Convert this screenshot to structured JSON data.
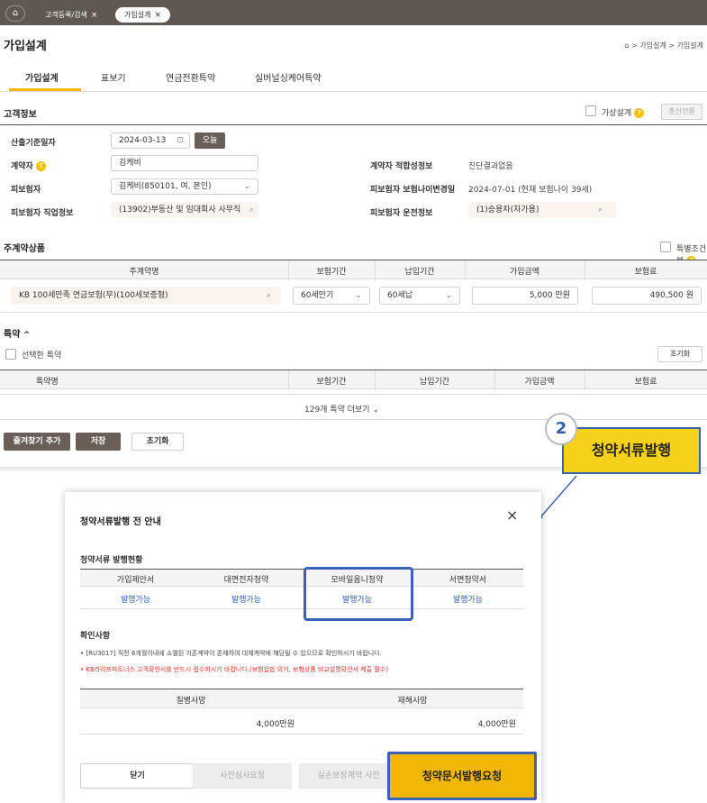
{
  "topbar": {
    "home_icon": "home-icon",
    "tabs": [
      {
        "label": "고객등록/검색",
        "close": "×"
      },
      {
        "label": "가입설계",
        "close": "×"
      }
    ]
  },
  "header": {
    "title": "가입설계",
    "breadcrumb": "⌂ > 가입설계 > 가입설계"
  },
  "subtabs": [
    "가입설계",
    "표보기",
    "연금전환특약",
    "실버널싱케어특약"
  ],
  "customer": {
    "section_title": "고객정보",
    "virtual_design_label": "가상설계",
    "total_convert_label": "총신전환",
    "calc_date_label": "산출기준일자",
    "calc_date_value": "2024-03-13",
    "today_label": "오늘",
    "contractor_label": "계약자",
    "contractor_value": "김케비",
    "suitability_label": "계약자 적합성정보",
    "suitability_value": "진단결과없음",
    "insured_label": "피보험자",
    "insured_value": "김케비(850101, 여, 본인)",
    "age_change_label": "피보험자 보험나이변경일",
    "age_change_value": "2024-07-01 (현재 보험나이 39세)",
    "job_label": "피보험자 직업정보",
    "job_value": "(13902)부동산 및 임대회사 사무직",
    "driving_label": "피보험자 운전정보",
    "driving_value": "(1)승용차(자가용)"
  },
  "main_product": {
    "section_title": "주계약상품",
    "special_cond_label": "특별조건부",
    "columns": [
      "주계약명",
      "보험기간",
      "납입기간",
      "가입금액",
      "보험료"
    ],
    "name": "KB 100세만족 연금보험(무)(100세보증형)",
    "period": "60세만기",
    "pay_period": "60세납",
    "amount": "5,000 만원",
    "premium": "490,500 원"
  },
  "rider": {
    "section_title": "특약",
    "collapse_icon": "^",
    "selected_label": "선택한 특약",
    "reset_label": "초기화",
    "columns": [
      "특약명",
      "보험기간",
      "납입기간",
      "가입금액",
      "보험료"
    ],
    "more_label": "129개 특약 더보기 ⌄"
  },
  "bottom_buttons": {
    "favorite": "즐겨찾기 추가",
    "save": "저장",
    "reset": "초기화"
  },
  "callout": {
    "step": "2",
    "label": "청약서류발행"
  },
  "modal": {
    "title": "청약서류발행 전 안내",
    "close_icon": "×",
    "status_title": "청약서류 발행현황",
    "status_columns": [
      "가입제안서",
      "대면전자청약",
      "모바일옴니청약",
      "서면청약서"
    ],
    "status_values": [
      "발행가능",
      "발행가능",
      "발행가능",
      "발행가능"
    ],
    "check_title": "확인사항",
    "note1": "• [RU3017] 직전 6개월이내에 소멸된 기존계약이 존재하여 대체계약에 해당될 수 있으므로 확인하시기 바랍니다.",
    "note2": "• KB라이프파트너스 고객확인서를 반드시 접수하시기 바랍니다.(보험업법 의거, 보험상품 비교설명확인서 제출 필수)",
    "death_columns": [
      "질병사망",
      "재해사망"
    ],
    "death_values": [
      "4,000만원",
      "4,000만원"
    ],
    "btn_close": "닫기",
    "btn_pre_review": "사전심사요청",
    "btn_loss": "실손보장계약 사전",
    "btn_request": "청약문서발행요청"
  },
  "colors": {
    "accent": "#f2b705",
    "highlight_border": "#3a63b8",
    "topbar": "#5f5852",
    "link": "#2e5fb4",
    "warning": "#e0352b"
  }
}
